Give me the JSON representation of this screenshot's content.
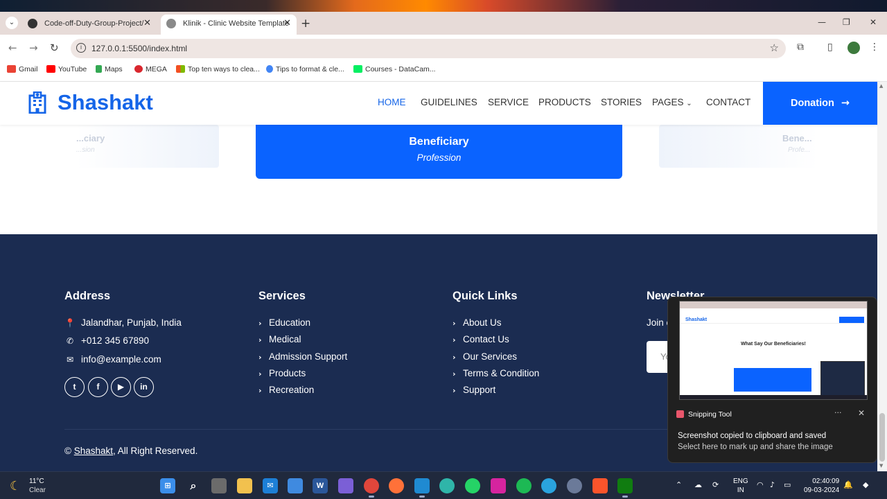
{
  "browser": {
    "tabs": [
      {
        "title": "Code-off-Duty-Group-Project/"
      },
      {
        "title": "Klinik - Clinic Website Template"
      }
    ],
    "url": "127.0.0.1:5500/index.html",
    "bookmarks": [
      {
        "label": "Gmail",
        "color": "#ea4335"
      },
      {
        "label": "YouTube",
        "color": "#ff0000"
      },
      {
        "label": "Maps",
        "color": "#34a853"
      },
      {
        "label": "MEGA",
        "color": "#d9272e"
      },
      {
        "label": "Top ten ways to clea...",
        "color": "#f25022"
      },
      {
        "label": "Tips to format & cle...",
        "color": "#4285f4"
      },
      {
        "label": "Courses - DataCam...",
        "color": "#03ef62"
      }
    ]
  },
  "site": {
    "brand": "Shashakt",
    "nav": [
      "HOME",
      "GUIDELINES",
      "SERVICE",
      "PRODUCTS",
      "STORIES",
      "PAGES",
      "CONTACT"
    ],
    "donate_label": "Donation",
    "carousel": {
      "left_ghost": {
        "name": "...ciary",
        "sub": "...sion"
      },
      "active": {
        "name": "Beneficiary",
        "profession": "Profession"
      },
      "right_ghost": {
        "name": "Bene...",
        "sub": "Profe..."
      }
    },
    "footer": {
      "address": {
        "heading": "Address",
        "location": "Jalandhar, Punjab, India",
        "phone": "+012 345 67890",
        "email": "info@example.com"
      },
      "services": {
        "heading": "Services",
        "items": [
          "Education",
          "Medical",
          "Admission Support",
          "Products",
          "Recreation"
        ]
      },
      "quick_links": {
        "heading": "Quick Links",
        "items": [
          "About Us",
          "Contact Us",
          "Our Services",
          "Terms & Condition",
          "Support"
        ]
      },
      "newsletter": {
        "heading": "Newsletter",
        "text": "Join o",
        "placeholder": "Yo"
      },
      "copyright_prefix": "©",
      "copyright_brand": "Shashakt",
      "copyright_suffix": ", All Right Reserved."
    }
  },
  "notification": {
    "app": "Snipping Tool",
    "title": "Screenshot copied to clipboard and saved",
    "body": "Select here to mark up and share the image",
    "preview_heading": "What Say Our Beneficiaries!"
  },
  "taskbar": {
    "temp": "11°C",
    "condition": "Clear",
    "lang1": "ENG",
    "lang2": "IN",
    "time": "02:40:09",
    "date": "09-03-2024"
  }
}
